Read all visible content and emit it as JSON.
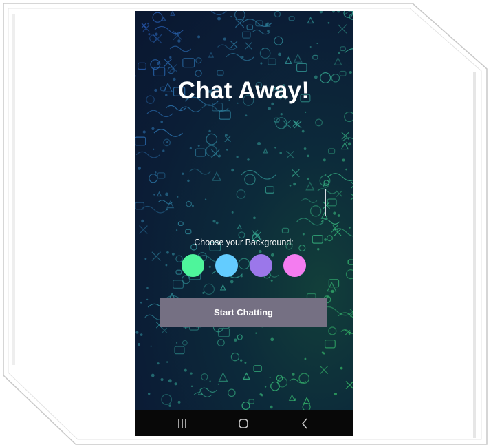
{
  "app": {
    "title": "Chat Away!"
  },
  "name_input": {
    "value": "",
    "placeholder": ""
  },
  "background": {
    "label": "Choose your Background:",
    "colors": [
      {
        "name": "green",
        "hex": "#4ef59b"
      },
      {
        "name": "light-blue",
        "hex": "#63ccff"
      },
      {
        "name": "purple",
        "hex": "#9b77ea"
      },
      {
        "name": "pink",
        "hex": "#f47cf0"
      }
    ]
  },
  "start_button": {
    "label": "Start Chatting",
    "color": "#757083"
  },
  "navbar": {
    "icons": [
      "recent-apps-icon",
      "home-icon",
      "back-icon"
    ]
  }
}
